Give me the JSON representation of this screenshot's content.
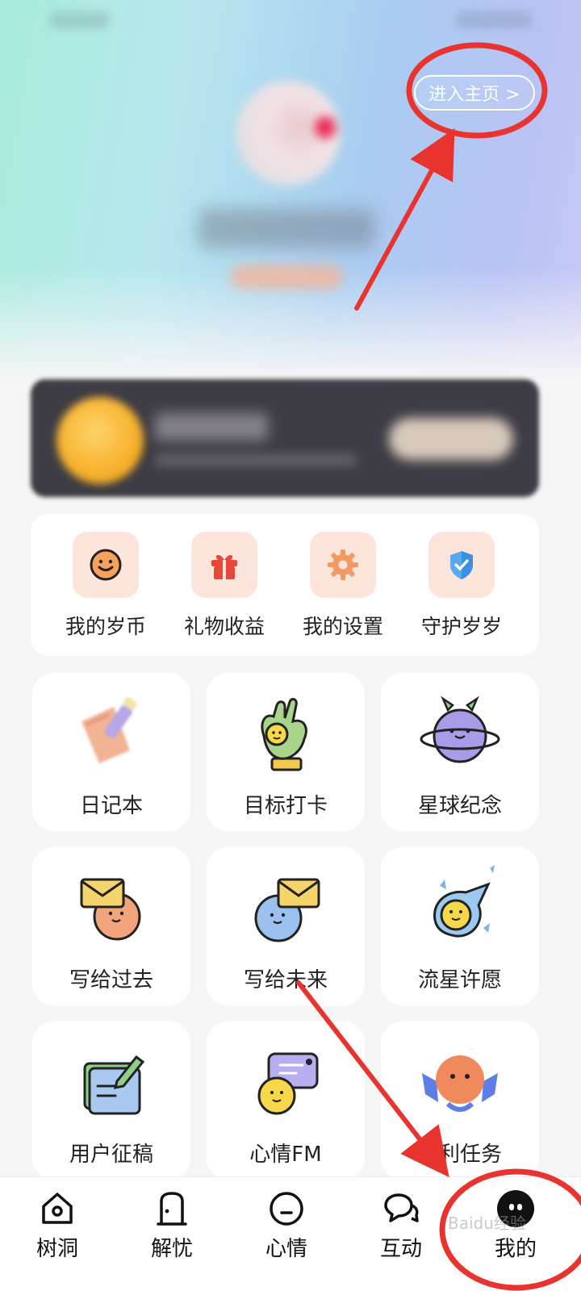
{
  "header": {
    "home_button": "进入主页 >"
  },
  "quick_actions": [
    {
      "label": "我的岁币",
      "icon": "smile-coin-icon"
    },
    {
      "label": "礼物收益",
      "icon": "gift-icon"
    },
    {
      "label": "我的设置",
      "icon": "gear-icon"
    },
    {
      "label": "守护岁岁",
      "icon": "shield-check-icon"
    }
  ],
  "features": [
    {
      "label": "日记本",
      "icon": "diary-icon"
    },
    {
      "label": "目标打卡",
      "icon": "ok-hand-icon"
    },
    {
      "label": "星球纪念",
      "icon": "planet-icon"
    },
    {
      "label": "写给过去",
      "icon": "letter-past-icon"
    },
    {
      "label": "写给未来",
      "icon": "letter-future-icon"
    },
    {
      "label": "流星许愿",
      "icon": "meteor-icon"
    },
    {
      "label": "用户征稿",
      "icon": "submission-icon"
    },
    {
      "label": "心情FM",
      "icon": "radio-icon"
    },
    {
      "label": "福利任务",
      "icon": "reward-icon"
    }
  ],
  "bottom_nav": [
    {
      "label": "树洞",
      "icon": "house-icon"
    },
    {
      "label": "解忧",
      "icon": "door-icon"
    },
    {
      "label": "心情",
      "icon": "face-icon"
    },
    {
      "label": "互动",
      "icon": "chat-icon"
    },
    {
      "label": "我的",
      "icon": "profile-icon"
    }
  ],
  "colors": {
    "accent_tile_bg": "#fde5dc",
    "annotation_red": "#e8332f"
  },
  "watermark": "Baidu经验"
}
